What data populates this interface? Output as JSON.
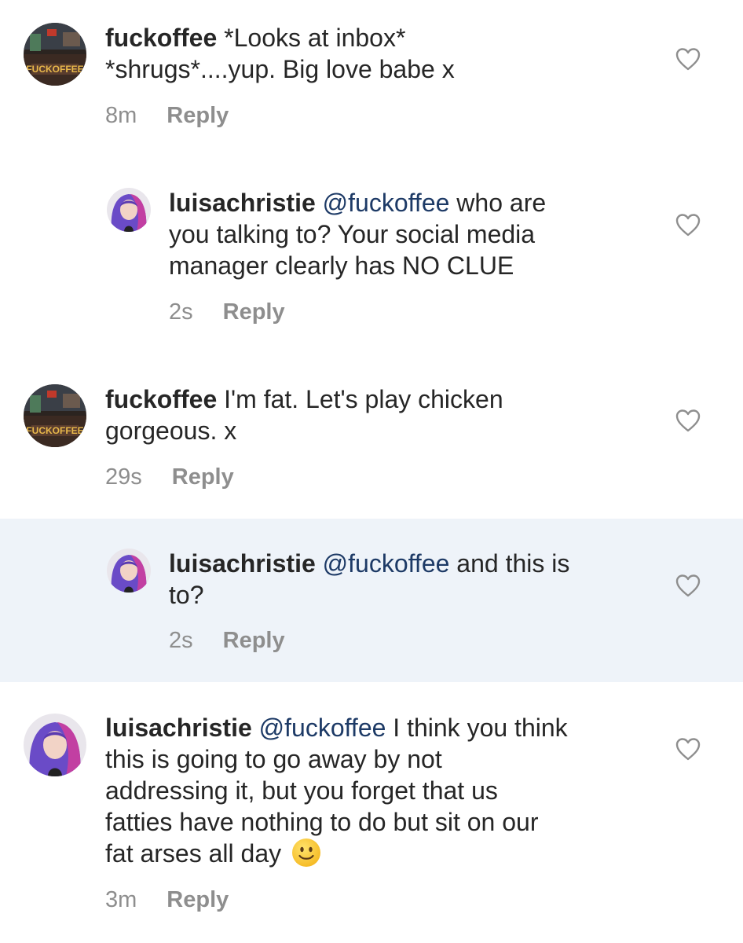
{
  "comments": [
    {
      "username": "fuckoffee",
      "lines": [
        "*Looks at inbox*",
        "*shrugs*....yup. Big love babe x"
      ],
      "mention": "",
      "time": "8m",
      "reply_label": "Reply",
      "avatar_text": "FUCKOFFEE",
      "avatar": "fuckoffee-logo",
      "highlighted": false,
      "nested": false
    },
    {
      "username": "luisachristie",
      "mention": "@fuckoffee",
      "lines": [
        "who are",
        "you talking to? Your social media",
        "manager clearly has NO CLUE"
      ],
      "time": "2s",
      "reply_label": "Reply",
      "avatar": "luisachristie-photo",
      "highlighted": false,
      "nested": true
    },
    {
      "username": "fuckoffee",
      "lines": [
        "I'm fat. Let's play chicken",
        "gorgeous. x"
      ],
      "mention": "",
      "time": "29s",
      "reply_label": "Reply",
      "avatar_text": "FUCKOFFEE",
      "avatar": "fuckoffee-logo",
      "highlighted": false,
      "nested": false
    },
    {
      "username": "luisachristie",
      "mention": "@fuckoffee",
      "lines": [
        "and this is",
        "to?"
      ],
      "time": "2s",
      "reply_label": "Reply",
      "avatar": "luisachristie-photo",
      "highlighted": true,
      "nested": true
    },
    {
      "username": "luisachristie",
      "mention": "@fuckoffee",
      "lines": [
        "I think you think",
        "this is going to go away by not",
        "addressing it, but you forget that us",
        "fatties have nothing to do but sit on our",
        "fat arses all day"
      ],
      "emoji": "slightly-smiling-face",
      "time": "3m",
      "reply_label": "Reply",
      "avatar": "luisachristie-photo",
      "highlighted": false,
      "nested": false
    }
  ],
  "icons": {
    "like": "heart-outline-icon"
  },
  "colors": {
    "text": "#262626",
    "meta": "#8e8e8e",
    "mention": "#1d3a66",
    "highlight_bg": "#eef3f9"
  }
}
